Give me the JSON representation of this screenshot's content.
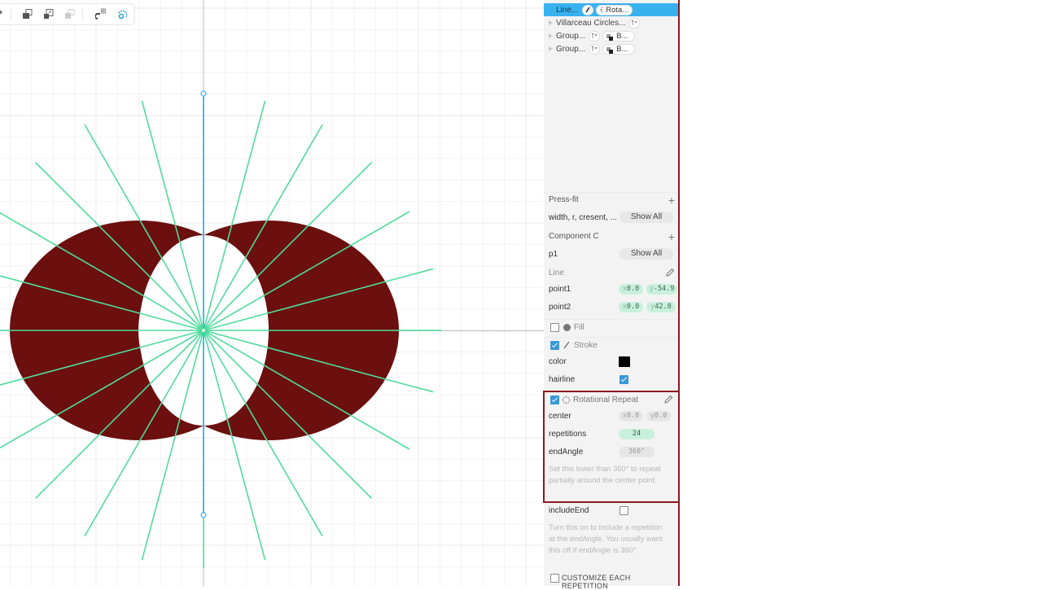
{
  "toolbar": {
    "buttons": [
      {
        "name": "tool-partial-icon",
        "state": "normal"
      },
      {
        "name": "send-backward-icon",
        "state": "normal"
      },
      {
        "name": "bring-forward-icon",
        "state": "normal"
      },
      {
        "name": "bring-to-front-icon",
        "state": "disabled"
      },
      {
        "name": "snap-grid-icon",
        "state": "normal"
      },
      {
        "name": "rotate-snap-icon",
        "state": "active"
      }
    ]
  },
  "colors": {
    "accent": "#38b2ef",
    "shape_fill": "#6b0f0f",
    "ray_color": "#4fdc9b",
    "selected_line": "#3aaee8",
    "highlight_border": "#8b1a1f"
  },
  "canvas": {
    "rotational_repeat_rays": 24,
    "shape": "Villarceau crescent pair"
  },
  "tree": {
    "items": [
      {
        "label": "Line...",
        "modifier_icon": "stroke-icon",
        "tag": "Rota...",
        "tag_icon": "rotational-repeat-icon",
        "selected": true,
        "expandable": false
      },
      {
        "label": "Villarceau Circles...",
        "modifier_icon": "transform-icon",
        "selected": false,
        "expandable": true
      },
      {
        "label": "Group...",
        "modifier_icon": "transform-icon",
        "tag": "B...",
        "tag_icon": "boolean-icon",
        "selected": false,
        "expandable": true
      },
      {
        "label": "Group...",
        "modifier_icon": "transform-icon",
        "tag": "B...",
        "tag_icon": "boolean-icon",
        "selected": false,
        "expandable": true
      }
    ]
  },
  "inspector": {
    "pressfit": {
      "title": "Press-fit",
      "params": "width, r, cresent, ...",
      "show_all": "Show All"
    },
    "component": {
      "title": "Component C",
      "params": "p1",
      "show_all": "Show All"
    },
    "line": {
      "title": "Line",
      "point1": {
        "label": "point1",
        "x_axis": "x",
        "x": "0.0",
        "y_axis": "y",
        "y": "-54.9"
      },
      "point2": {
        "label": "point2",
        "x_axis": "x",
        "x": "0.0",
        "y_axis": "y",
        "y": "42.8"
      }
    },
    "fill": {
      "label": "Fill",
      "checked": false
    },
    "stroke": {
      "label": "Stroke",
      "checked": true,
      "color_label": "color",
      "color": "#000000",
      "hairline_label": "hairline",
      "hairline": true
    },
    "rotational_repeat": {
      "label": "Rotational Repeat",
      "checked": true,
      "center_label": "center",
      "center_x_axis": "x",
      "center_x": "0.0",
      "center_y_axis": "y",
      "center_y": "0.0",
      "repetitions_label": "repetitions",
      "repetitions": "24",
      "endangle_label": "endAngle",
      "endangle": "360°",
      "endangle_help": "Set this lower than 360° to repeat partially around the center point.",
      "includeend_label": "includeEnd",
      "includeend": false,
      "includeend_help": "Turn this on to include a repetition at the endAngle. You usually want this off if endAngle is 360°.",
      "customize_label": "CUSTOMIZE EACH REPETITION",
      "customize": false
    }
  }
}
